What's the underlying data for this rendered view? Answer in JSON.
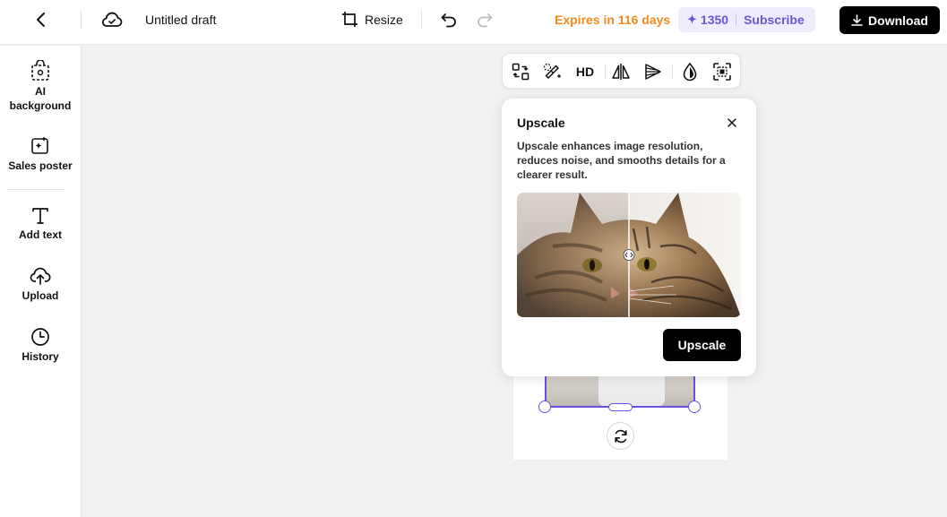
{
  "header": {
    "title": "Untitled draft",
    "resize_label": "Resize",
    "expires_text": "Expires in 116 days",
    "credits": "1350",
    "subscribe_label": "Subscribe",
    "download_label": "Download"
  },
  "sidebar": {
    "items": [
      {
        "label": "AI background",
        "icon": "ai-background-icon"
      },
      {
        "label": "Sales poster",
        "icon": "sales-poster-icon"
      },
      {
        "label": "Add text",
        "icon": "text-icon"
      },
      {
        "label": "Upload",
        "icon": "upload-icon"
      },
      {
        "label": "History",
        "icon": "history-icon"
      }
    ]
  },
  "toolbar": {
    "hd_label": "HD",
    "tools": [
      "replace-icon",
      "magic-eraser-icon",
      "hd-icon",
      "flip-icon",
      "perspective-icon",
      "opacity-icon",
      "focus-icon"
    ]
  },
  "popover": {
    "title": "Upscale",
    "description": "Upscale enhances image resolution, reduces noise, and smooths details for a clearer result.",
    "button_label": "Upscale"
  },
  "colors": {
    "accent": "#6d4fe0",
    "expires": "#f5891f",
    "credits_bg": "#efedfb",
    "credits_text": "#6a55d8",
    "primary_button": "#000000"
  }
}
